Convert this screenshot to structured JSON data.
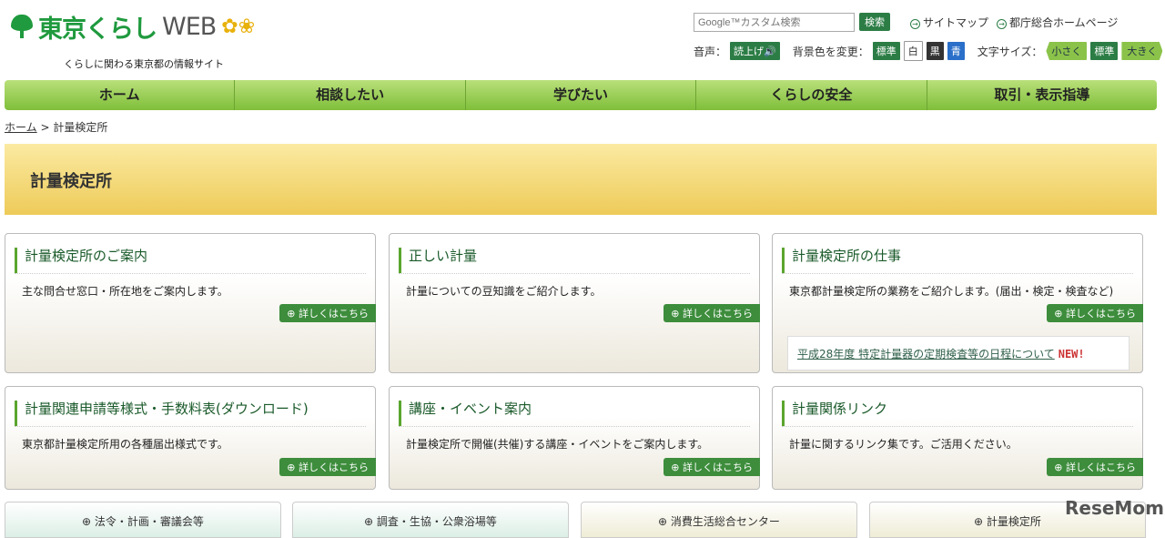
{
  "header": {
    "logo_text_a": "東京くらし",
    "logo_text_b": "WEB",
    "tagline": "くらしに関わる東京都の情報サイト",
    "search_placeholder": "Google™カスタム検索",
    "search_button": "検索",
    "links": [
      "サイトマップ",
      "都庁総合ホームページ"
    ]
  },
  "accessibility": {
    "voice_label": "音声：",
    "voice_button": "読上げ🔊",
    "bg_label": "背景色を変更：",
    "bg_options": [
      "標準",
      "白",
      "黒",
      "青"
    ],
    "size_label": "文字サイズ：",
    "size_options": [
      "小さく",
      "標準",
      "大きく"
    ]
  },
  "nav": [
    "ホーム",
    "相談したい",
    "学びたい",
    "くらしの安全",
    "取引・表示指導"
  ],
  "breadcrumb": {
    "home": "ホーム",
    "sep": ">",
    "current": "計量検定所"
  },
  "page_title": "計量検定所",
  "cards": [
    {
      "title": "計量検定所のご案内",
      "desc": "主な問合せ窓口・所在地をご案内します。",
      "more": "詳しくはこちら"
    },
    {
      "title": "正しい計量",
      "desc": "計量についての豆知識をご紹介します。",
      "more": "詳しくはこちら"
    },
    {
      "title": "計量検定所の仕事",
      "desc": "東京都計量検定所の業務をご紹介します。(届出・検定・検査など)",
      "more": "詳しくはこちら",
      "news": "平成28年度 特定計量器の定期検査等の日程について",
      "news_badge": "NEW!"
    },
    {
      "title": "計量関連申請等様式・手数料表(ダウンロード)",
      "desc": "東京都計量検定所用の各種届出様式です。",
      "more": "詳しくはこちら"
    },
    {
      "title": "講座・イベント案内",
      "desc": "計量検定所で開催(共催)する講座・イベントをご案内します。",
      "more": "詳しくはこちら"
    },
    {
      "title": "計量関係リンク",
      "desc": "計量に関するリンク集です。ご活用ください。",
      "more": "詳しくはこちら"
    }
  ],
  "bottom_links": [
    "法令・計画・審議会等",
    "調査・生協・公衆浴場等",
    "消費生活総合センター",
    "計量検定所"
  ],
  "watermark": "ReseMom"
}
